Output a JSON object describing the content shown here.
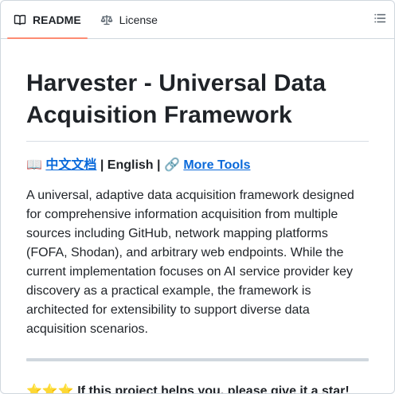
{
  "tabs": [
    {
      "label": "README",
      "icon": "book-icon",
      "active": true
    },
    {
      "label": "License",
      "icon": "scale-icon",
      "active": false
    }
  ],
  "outline_icon": "list-unordered-icon",
  "readme": {
    "title": "Harvester - Universal Data Acquisition Framework",
    "lang": {
      "book_emoji": "📖",
      "chinese_link": "中文文档",
      "sep1": "|",
      "english": "English",
      "sep2": "|",
      "link_emoji": "🔗",
      "more_tools": "More Tools"
    },
    "description": "A universal, adaptive data acquisition framework designed for comprehensive information acquisition from multiple sources including GitHub, network mapping platforms (FOFA, Shodan), and arbitrary web endpoints. While the current implementation focuses on AI service provider key discovery as a practical example, the framework is architected for extensibility to support diverse data acquisition scenarios.",
    "stars": "⭐⭐⭐",
    "star_text": "If this project helps you, please give it a star!"
  },
  "colors": {
    "link": "#0969da",
    "active_tab_underline": "#fd8c73",
    "border": "#d0d7de"
  }
}
